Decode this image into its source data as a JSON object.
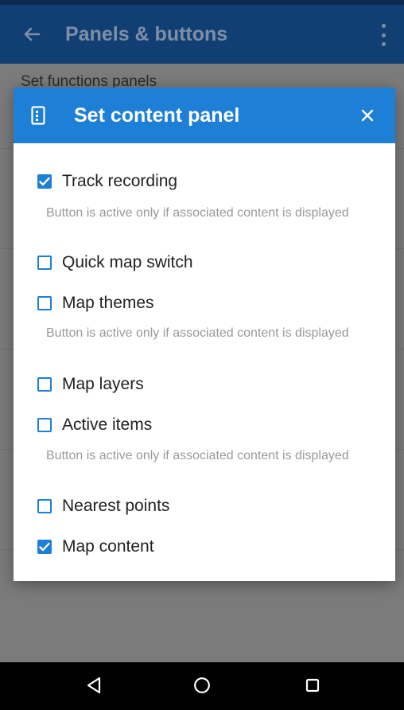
{
  "appbar": {
    "title": "Panels & buttons",
    "back_icon": "arrow-left-icon",
    "more_icon": "more-vertical-icon"
  },
  "background": {
    "section_title": "Set functions panels"
  },
  "dialog": {
    "title": "Set content panel",
    "header_icon": "panel-icon",
    "close_icon": "close-icon",
    "options": [
      {
        "label": "Track recording",
        "checked": true,
        "note": "Button is active only if associated content is displayed"
      },
      {
        "label": "Quick map switch",
        "checked": false
      },
      {
        "label": "Map themes",
        "checked": false,
        "note": "Button is active only if associated content is displayed"
      },
      {
        "label": "Map layers",
        "checked": false
      },
      {
        "label": "Active items",
        "checked": false,
        "note": "Button is active only if associated content is displayed"
      },
      {
        "label": "Nearest points",
        "checked": false
      },
      {
        "label": "Map content",
        "checked": true
      }
    ]
  },
  "navbar": {
    "back_icon": "nav-back-triangle-icon",
    "home_icon": "nav-home-circle-icon",
    "recents_icon": "nav-recents-square-icon"
  },
  "colors": {
    "appbar": "#123f73",
    "dialog_header": "#1e7fd6",
    "checkbox": "#1e7fd6",
    "dim_background": "#7b7b7b"
  }
}
